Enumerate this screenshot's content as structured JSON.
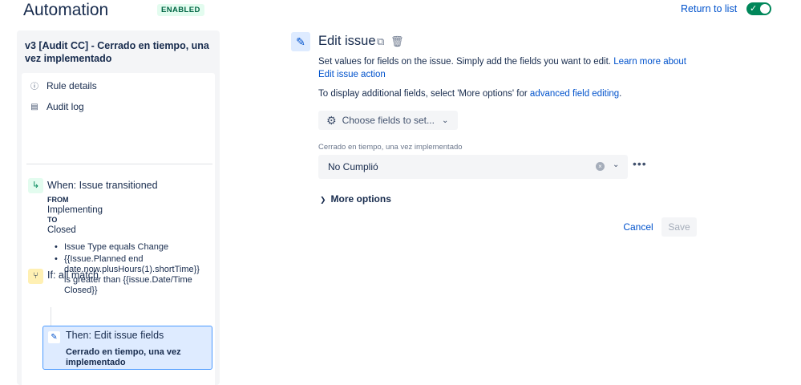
{
  "header": {
    "title": "Automation",
    "badge": "ENABLED",
    "return_link": "Return to list",
    "toggle_state": "on"
  },
  "rule": {
    "name": "v3 [Audit CC] - Cerrado en tiempo, una vez implementado",
    "nav": [
      {
        "label": "Rule details",
        "icon": "info-icon"
      },
      {
        "label": "Audit log",
        "icon": "document-icon"
      }
    ],
    "trigger": {
      "title": "When: Issue transitioned",
      "from_label": "FROM",
      "from_value": "Implementing",
      "to_label": "TO",
      "to_value": "Closed"
    },
    "condition": {
      "title": "If: all match",
      "items": [
        "Issue Type equals Change",
        "{{Issue.Planned end date.now.plusHours(1).shortTime}} is greater than {{issue.Date/Time Closed}}"
      ]
    },
    "action": {
      "title": "Then: Edit issue fields",
      "subtitle": "Cerrado en tiempo, una vez implementado"
    }
  },
  "editor": {
    "title": "Edit issue",
    "description_text": "Set values for fields on the issue. Simply add the fields you want to edit. ",
    "description_link": "Learn more about Edit issue action",
    "additional_text": "To display additional fields, select 'More options' for ",
    "additional_link": "advanced field editing",
    "additional_suffix": ".",
    "choose_fields_label": "Choose fields to set...",
    "field_label": "Cerrado en tiempo, una vez implementado",
    "field_value": "No Cumplió",
    "more_options_label": "More options",
    "cancel_label": "Cancel",
    "save_label": "Save"
  },
  "colors": {
    "accent": "#0052cc",
    "toggle_on": "#00875a",
    "badge_bg": "#e3fcef",
    "badge_text": "#006644"
  }
}
